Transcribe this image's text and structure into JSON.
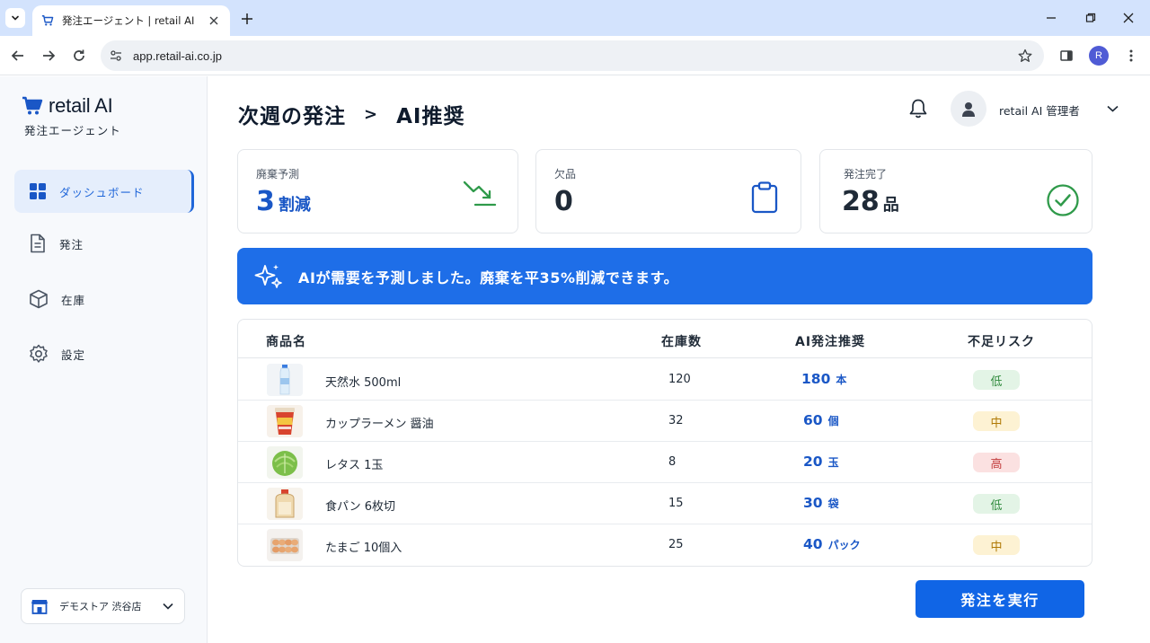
{
  "browser": {
    "tab_title": "発注エージェント | retail AI",
    "url": "app.retail-ai.co.jp",
    "profile_initial": "R"
  },
  "sidebar": {
    "brand_name": "retail AI",
    "brand_sub": "発注エージェント",
    "items": [
      {
        "label": "ダッシュボード",
        "icon": "dashboard-grid-icon",
        "active": true
      },
      {
        "label": "発注",
        "icon": "document-icon",
        "active": false
      },
      {
        "label": "在庫",
        "icon": "box-icon",
        "active": false
      },
      {
        "label": "設定",
        "icon": "gear-icon",
        "active": false
      }
    ],
    "store": "デモストア 渋谷店"
  },
  "header": {
    "title_part1": "次週の発注",
    "separator": ">",
    "title_part2": "AI推奨",
    "user_name": "retail AI 管理者"
  },
  "cards": [
    {
      "label": "廃棄予測",
      "value": "3",
      "unit": "割減",
      "icon": "trend-down-icon",
      "color": "#1a57c6"
    },
    {
      "label": "欠品",
      "value": "0",
      "unit": "",
      "icon": "clipboard-icon",
      "color": "#1f2a37"
    },
    {
      "label": "発注完了",
      "value": "28",
      "unit": "品",
      "icon": "check-circle-icon",
      "color": "#1f2a37"
    }
  ],
  "banner": {
    "text": "AIが需要を予測しました。廃棄を平35%削減できます。",
    "icon": "sparkle-icon"
  },
  "table": {
    "headers": [
      "商品名",
      "在庫数",
      "AI発注推奨",
      "不足リスク"
    ],
    "rows": [
      {
        "name": "天然水 500ml",
        "stock": "120",
        "rec": "180",
        "unit": "本",
        "risk": "低",
        "level": "low",
        "thumb": "water-bottle"
      },
      {
        "name": "カップラーメン 醤油",
        "stock": "32",
        "rec": "60",
        "unit": "個",
        "risk": "中",
        "level": "mid",
        "thumb": "cup-noodle"
      },
      {
        "name": "レタス 1玉",
        "stock": "8",
        "rec": "20",
        "unit": "玉",
        "risk": "高",
        "level": "high",
        "thumb": "lettuce"
      },
      {
        "name": "食パン 6枚切",
        "stock": "15",
        "rec": "30",
        "unit": "袋",
        "risk": "低",
        "level": "low",
        "thumb": "bread"
      },
      {
        "name": "たまご 10個入",
        "stock": "25",
        "rec": "40",
        "unit": "パック",
        "risk": "中",
        "level": "mid",
        "thumb": "egg-pack"
      }
    ]
  },
  "actions": {
    "execute_label": "発注を実行"
  },
  "colors": {
    "accent": "#1e6ee8",
    "button": "#1065e6",
    "risk_low": "#2f8a3c",
    "risk_mid": "#b07a06",
    "risk_high": "#c23b3b"
  }
}
